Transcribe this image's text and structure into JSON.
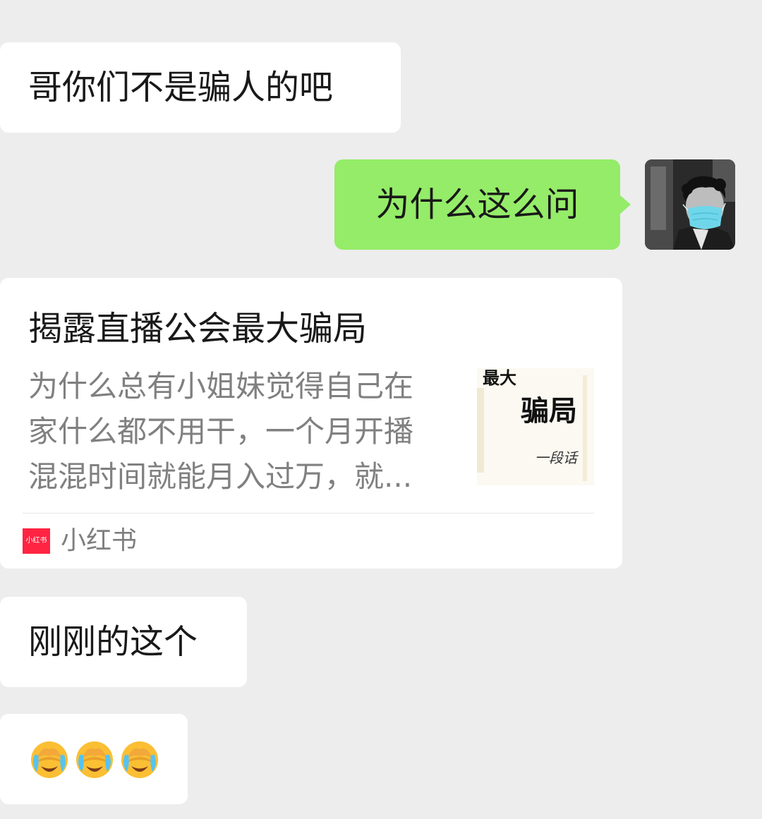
{
  "messages": [
    {
      "side": "left",
      "text": "哥你们不是骗人的吧"
    },
    {
      "side": "right",
      "text": "为什么这么问"
    },
    {
      "side": "left",
      "text": "刚刚的这个"
    }
  ],
  "card": {
    "title": "揭露直播公会最大骗局",
    "description": "为什么总有小姐妹觉得自己在\n家什么都不用干，一个月开播\n混混时间就能月入过万，就...",
    "thumbnail_text": {
      "line1": "最大",
      "line2": "骗局",
      "line3": "一段话"
    },
    "source_icon_text": "小红书",
    "source_name": "小红书"
  },
  "emoji": {
    "name": "crying-face-with-hand-icon",
    "count": 3
  },
  "colors": {
    "background": "#ededed",
    "incoming_bubble": "#ffffff",
    "outgoing_bubble": "#95ec69",
    "brand_red": "#ff2442"
  }
}
